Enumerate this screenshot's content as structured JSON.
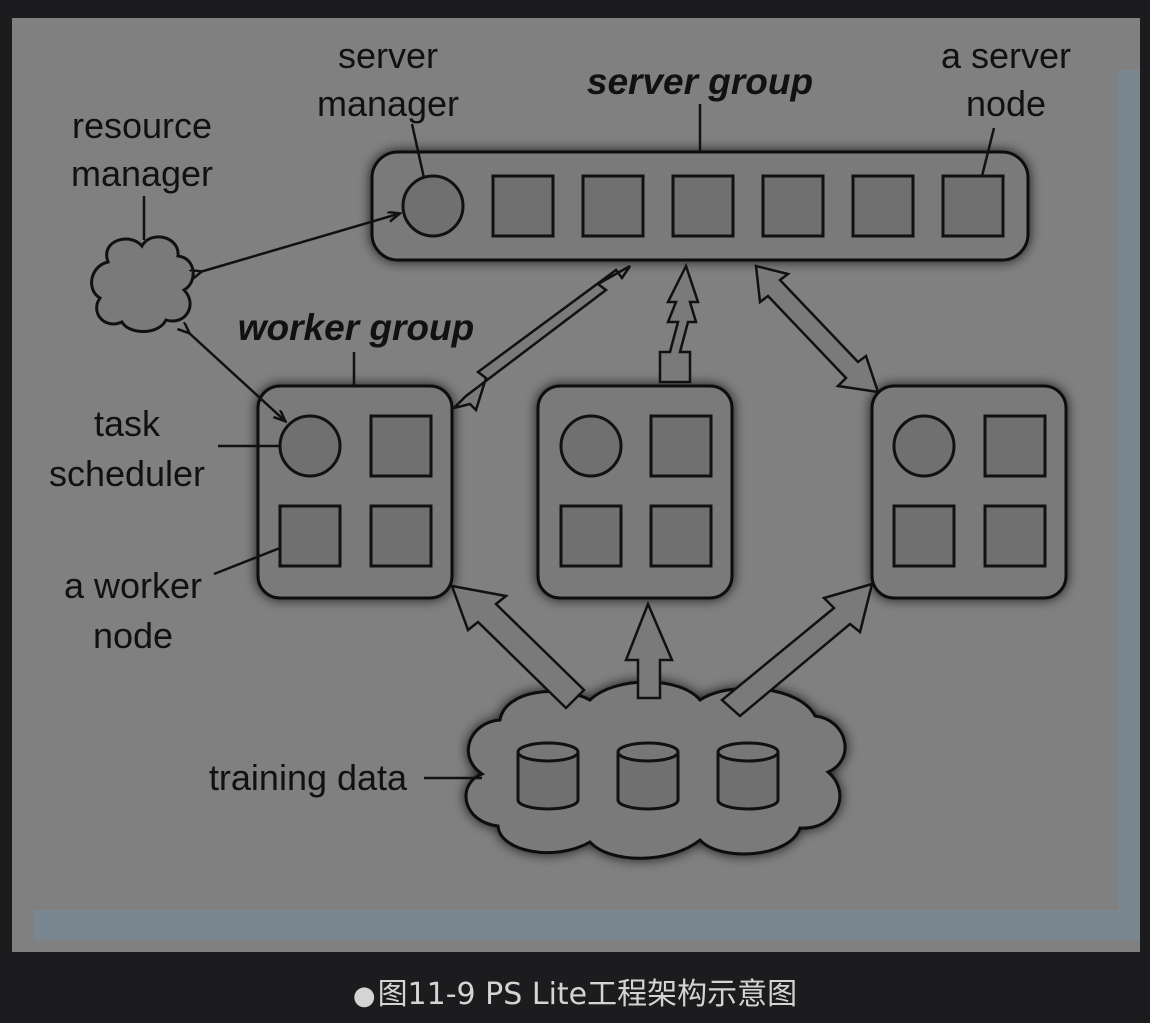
{
  "diagram": {
    "labels": {
      "server_manager_line1": "server",
      "server_manager_line2": "manager",
      "server_group": "server group",
      "a_server_line1": "a server",
      "a_server_line2": "node",
      "resource_line1": "resource",
      "resource_line2": "manager",
      "worker_group": "worker group",
      "task_line1": "task",
      "task_line2": "scheduler",
      "worker_node_line1": "a worker",
      "worker_node_line2": "node",
      "training_data": "training data"
    },
    "colors": {
      "background": "#808080",
      "node_fill": "#707070",
      "stroke": "#111111",
      "right_strip": "#7a8790"
    }
  },
  "caption": {
    "bullet": "●",
    "text": "图11-9 PS Lite工程架构示意图"
  }
}
